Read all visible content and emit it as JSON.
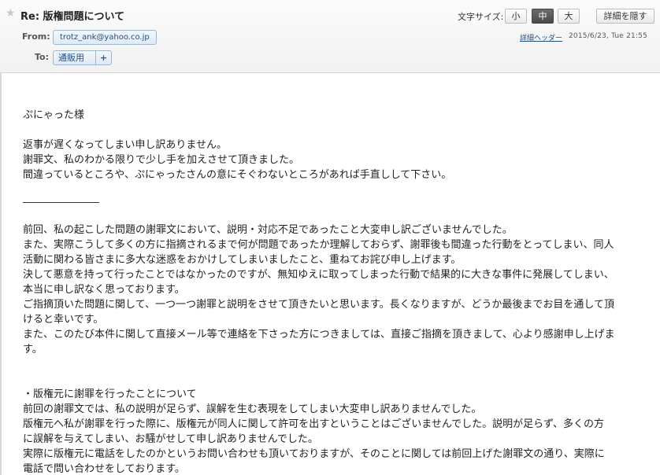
{
  "header": {
    "subject": "Re: 版権問題について",
    "font_size_label": "文字サイズ:",
    "font_sizes": [
      "小",
      "中",
      "大"
    ],
    "active_font_size": "中",
    "hide_details_label": "詳細を隠す",
    "from_label": "From:",
    "from_address": "trotz_ank@yahoo.co.jp",
    "to_label": "To:",
    "to_value": "通販用",
    "to_add_symbol": "+",
    "detail_header_link": "詳細ヘッダー",
    "date": "2015/6/23, Tue 21:55"
  },
  "message": {
    "greeting": "ぷにゃった様",
    "intro": [
      "返事が遅くなってしまい申し訳ありません。",
      "謝罪文、私のわかる限りで少し手を加えさせて頂きました。",
      "間違っているところや、ぷにゃったさんの意にそぐわないところがあれば手直しして下さい。"
    ],
    "para1": [
      "前回、私の起こした問題の謝罪文において、説明・対応不足であったこと大変申し訳ございませんでした。",
      "また、実際こうして多くの方に指摘されるまで何が問題であったか理解しておらず、謝罪後も間違った行動をとってしまい、同人",
      "活動に関わる皆さまに多大な迷惑をおかけしてしまいましたこと、重ねてお詫び申し上げます。",
      "決して悪意を持って行ったことではなかったのですが、無知ゆえに取ってしまった行動で結果的に大きな事件に発展してしまい、",
      "本当に申し訳なく思っております。",
      "ご指摘頂いた問題に関して、一つ一つ謝罪と説明をさせて頂きたいと思います。長くなりますが、どうか最後までお目を通して頂",
      "けると幸いです。",
      "また、このたび本件に関して直接メール等で連絡を下さった方につきましては、直接ご指摘を頂きまして、心より感謝申し上げま",
      "す。"
    ],
    "section_title": "・版権元に謝罪を行ったことについて",
    "para2": [
      "前回の謝罪文では、私の説明が足らず、誤解を生む表現をしてしまい大変申し訳ありませんでした。",
      "版権元へ私が謝罪を行った際に、版権元が同人に関して許可を出すということはございませんでした。説明が足らず、多くの方",
      "に誤解を与えてしまい、お騒がせして申し訳ありませんでした。",
      "実際に版権元に電話をしたのかというお問い合わせも頂いておりますが、そのことに関しては前回上げた謝罪文の通り、実際に",
      "電話で問い合わせをしております。"
    ]
  }
}
